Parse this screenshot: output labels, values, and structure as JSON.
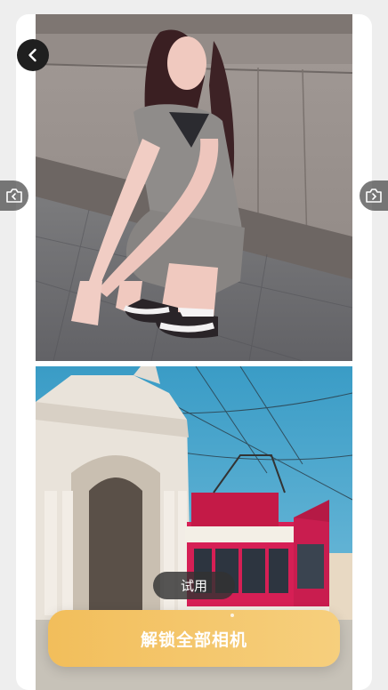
{
  "buttons": {
    "trial_label": "试用",
    "unlock_label": "解锁全部相机"
  },
  "icons": {
    "back": "chevron-left-icon",
    "prev": "camera-prev-icon",
    "next": "camera-next-icon"
  },
  "colors": {
    "unlock_gradient_start": "#f2be5b",
    "unlock_gradient_end": "#f6cf7d",
    "back_button_bg": "#1f1f1f"
  }
}
